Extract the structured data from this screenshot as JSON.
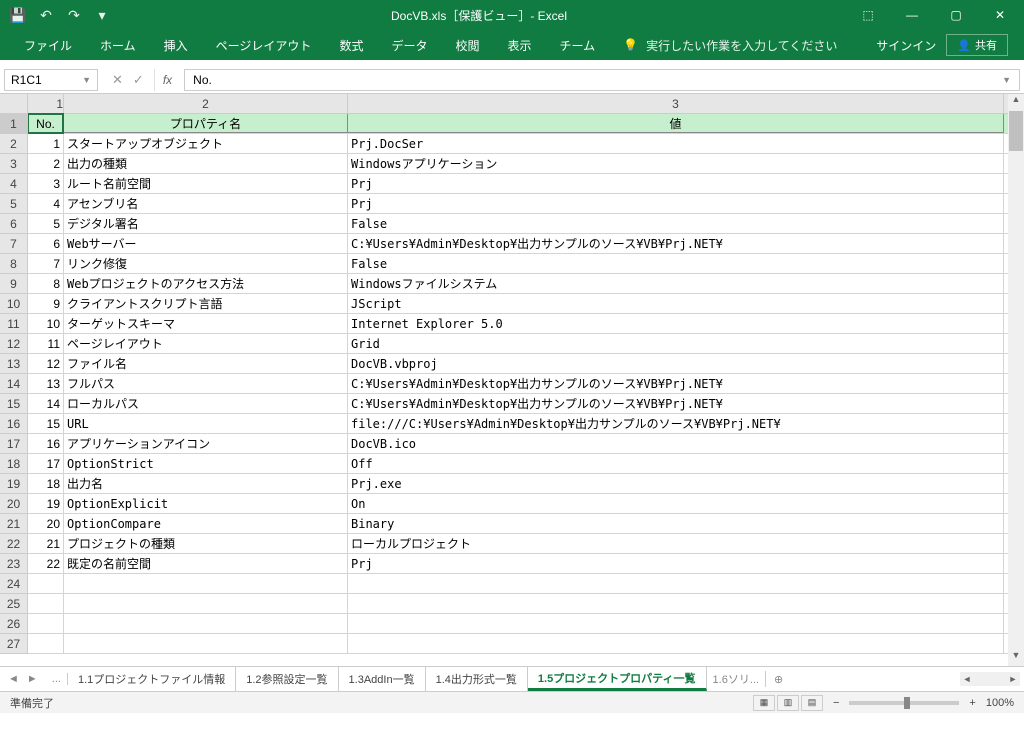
{
  "title": "DocVB.xls［保護ビュー］- Excel",
  "titlebar": {
    "undo_icon": "↶",
    "redo_icon": "↷",
    "save_icon": "💾",
    "dropdown_icon": "▾"
  },
  "windowControls": {
    "riboptions": "⬚",
    "minimize": "—",
    "maximize": "▢",
    "close": "✕"
  },
  "ribbon": {
    "tabs": [
      "ファイル",
      "ホーム",
      "挿入",
      "ページレイアウト",
      "数式",
      "データ",
      "校閲",
      "表示",
      "チーム"
    ],
    "tellme_icon": "💡",
    "tellme": "実行したい作業を入力してください",
    "signin": "サインイン",
    "share_icon": "👤",
    "share": "共有"
  },
  "nameBox": "R1C1",
  "formulaBar": {
    "fx": "fx",
    "value": "No.",
    "cancel": "✕",
    "confirm": "✓"
  },
  "columns": [
    "1",
    "2",
    "3"
  ],
  "headerRow": {
    "no": "No.",
    "prop": "プロパティ名",
    "val": "値"
  },
  "rows": [
    {
      "n": "1",
      "p": "スタートアップオブジェクト",
      "v": "Prj.DocSer"
    },
    {
      "n": "2",
      "p": "出力の種類",
      "v": "Windowsアプリケーション"
    },
    {
      "n": "3",
      "p": "ルート名前空間",
      "v": "Prj"
    },
    {
      "n": "4",
      "p": "アセンブリ名",
      "v": "Prj"
    },
    {
      "n": "5",
      "p": "デジタル署名",
      "v": "False"
    },
    {
      "n": "6",
      "p": "Webサーバー",
      "v": "C:¥Users¥Admin¥Desktop¥出力サンプルのソース¥VB¥Prj.NET¥"
    },
    {
      "n": "7",
      "p": "リンク修復",
      "v": "False"
    },
    {
      "n": "8",
      "p": "Webプロジェクトのアクセス方法",
      "v": "Windowsファイルシステム"
    },
    {
      "n": "9",
      "p": "クライアントスクリプト言語",
      "v": "JScript"
    },
    {
      "n": "10",
      "p": "ターゲットスキーマ",
      "v": "Internet Explorer 5.0"
    },
    {
      "n": "11",
      "p": "ページレイアウト",
      "v": "Grid"
    },
    {
      "n": "12",
      "p": "ファイル名",
      "v": "DocVB.vbproj"
    },
    {
      "n": "13",
      "p": "フルパス",
      "v": "C:¥Users¥Admin¥Desktop¥出力サンプルのソース¥VB¥Prj.NET¥"
    },
    {
      "n": "14",
      "p": "ローカルパス",
      "v": "C:¥Users¥Admin¥Desktop¥出力サンプルのソース¥VB¥Prj.NET¥"
    },
    {
      "n": "15",
      "p": "URL",
      "v": "file:///C:¥Users¥Admin¥Desktop¥出力サンプルのソース¥VB¥Prj.NET¥"
    },
    {
      "n": "16",
      "p": "アプリケーションアイコン",
      "v": "DocVB.ico"
    },
    {
      "n": "17",
      "p": "OptionStrict",
      "v": "Off"
    },
    {
      "n": "18",
      "p": "出力名",
      "v": "Prj.exe"
    },
    {
      "n": "19",
      "p": "OptionExplicit",
      "v": "On"
    },
    {
      "n": "20",
      "p": "OptionCompare",
      "v": "Binary"
    },
    {
      "n": "21",
      "p": "プロジェクトの種類",
      "v": "ローカルプロジェクト"
    },
    {
      "n": "22",
      "p": "既定の名前空間",
      "v": "Prj"
    }
  ],
  "emptyRows": [
    "24",
    "25",
    "26",
    "27"
  ],
  "rowHeaders": [
    "1",
    "2",
    "3",
    "4",
    "5",
    "6",
    "7",
    "8",
    "9",
    "10",
    "11",
    "12",
    "13",
    "14",
    "15",
    "16",
    "17",
    "18",
    "19",
    "20",
    "21",
    "22",
    "23",
    "24",
    "25",
    "26",
    "27"
  ],
  "sheetTabs": {
    "ellipsis": "...",
    "tabs": [
      "1.1プロジェクトファイル情報",
      "1.2参照設定一覧",
      "1.3AddIn一覧",
      "1.4出力形式一覧",
      "1.5プロジェクトプロパティ一覧"
    ],
    "activeIndex": 4,
    "truncated": "1.6ソリ...",
    "add": "⊕"
  },
  "status": {
    "ready": "準備完了",
    "zoom": "100%",
    "minus": "−",
    "plus": "+"
  }
}
